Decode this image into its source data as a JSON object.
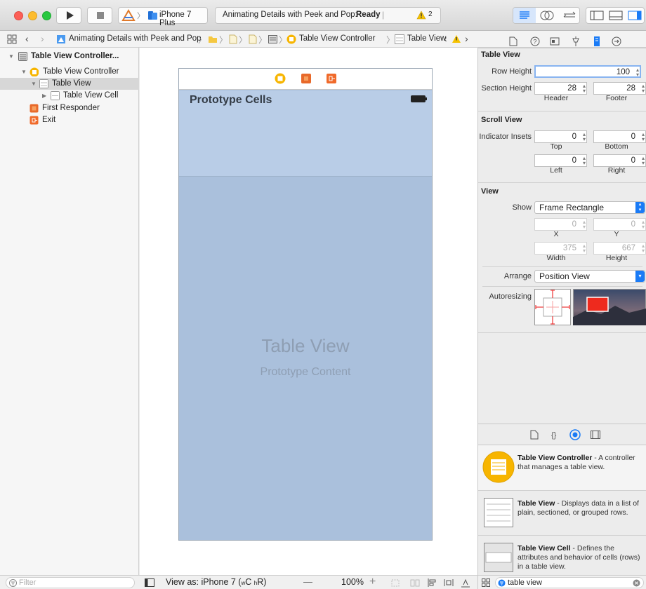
{
  "toolbar": {
    "scheme_device": "iPhone 7 Plus",
    "status_project": "Animating Details with Peek and Pop:",
    "status_state": "Ready",
    "warning_count": "2"
  },
  "jumpbar": {
    "project": "Animating Details with Peek and Pop",
    "controller": "Table View Controller",
    "view": "Table View"
  },
  "outline": {
    "items": [
      {
        "label": "Table View Controller..."
      },
      {
        "label": "Table View Controller"
      },
      {
        "label": "Table View"
      },
      {
        "label": "Table View Cell"
      },
      {
        "label": "First Responder"
      },
      {
        "label": "Exit"
      }
    ],
    "filter_placeholder": "Filter"
  },
  "canvas": {
    "nav_title": "Prototype Cells",
    "table_title": "Table View",
    "table_subtitle": "Prototype Content"
  },
  "bottombar": {
    "view_as": "View as: iPhone 7 (",
    "size_class_w": "w",
    "size_class_c": "C",
    "size_class_h": "h",
    "size_class_r": "R)",
    "minus": "—",
    "zoom": "100%",
    "plus": "+"
  },
  "inspector": {
    "table_view": {
      "section_title": "Table View",
      "row_height_label": "Row Height",
      "row_height_value": "100",
      "section_height_label": "Section Height",
      "header_value": "28",
      "footer_value": "28",
      "header_label": "Header",
      "footer_label": "Footer"
    },
    "scroll_view": {
      "section_title": "Scroll View",
      "indicator_insets_label": "Indicator Insets",
      "top_value": "0",
      "bottom_value": "0",
      "left_value": "0",
      "right_value": "0",
      "top_label": "Top",
      "bottom_label": "Bottom",
      "left_label": "Left",
      "right_label": "Right"
    },
    "view": {
      "section_title": "View",
      "show_label": "Show",
      "show_value": "Frame Rectangle",
      "x_value": "0",
      "y_value": "0",
      "x_label": "X",
      "y_label": "Y",
      "width_value": "375",
      "height_value": "667",
      "width_label": "Width",
      "height_label": "Height",
      "arrange_label": "Arrange",
      "arrange_value": "Position View",
      "autoresizing_label": "Autoresizing"
    },
    "library": [
      {
        "title": "Table View Controller",
        "desc": " - A controller that manages a table view."
      },
      {
        "title": "Table View",
        "desc": " - Displays data in a list of plain, sectioned, or grouped rows."
      },
      {
        "title": "Table View Cell",
        "desc": " - Defines the attributes and behavior of cells (rows) in a table view."
      }
    ],
    "search_value": "table view"
  },
  "colors": {
    "accent": "#1a7bf6",
    "storyboard_yellow": "#f7b500",
    "table_bg": "#aac0dc",
    "nav_bg": "#b9cde7"
  }
}
